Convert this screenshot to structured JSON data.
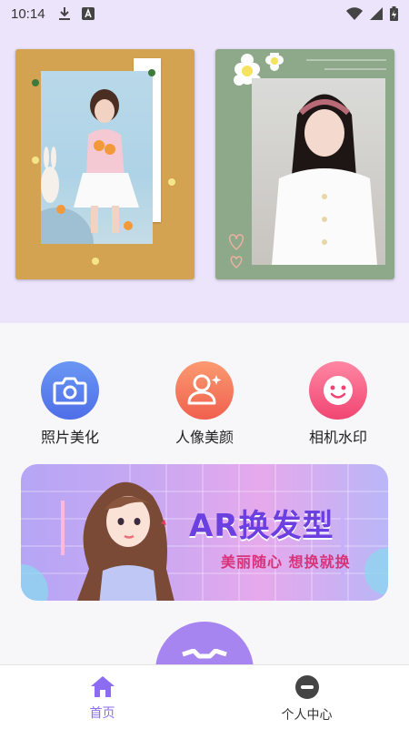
{
  "status_bar": {
    "time": "10:14"
  },
  "features": [
    {
      "label": "照片美化",
      "icon": "camera-icon",
      "color_from": "#6a97f3",
      "color_to": "#4f6ee8"
    },
    {
      "label": "人像美颜",
      "icon": "portrait-icon",
      "color_from": "#fb9a71",
      "color_to": "#f0604e"
    },
    {
      "label": "相机水印",
      "icon": "smiley-icon",
      "color_from": "#ff87a3",
      "color_to": "#f04572"
    }
  ],
  "banner": {
    "title": "AR换发型",
    "subtitle": "美丽随心  想换就换"
  },
  "bottom_nav": {
    "items": [
      {
        "label": "首页",
        "icon": "home-icon",
        "active": true
      },
      {
        "label": "个人中心",
        "icon": "profile-icon",
        "active": false
      }
    ]
  },
  "colors": {
    "accent": "#8b6cf2",
    "hero_bg": "#ebe4fb"
  }
}
